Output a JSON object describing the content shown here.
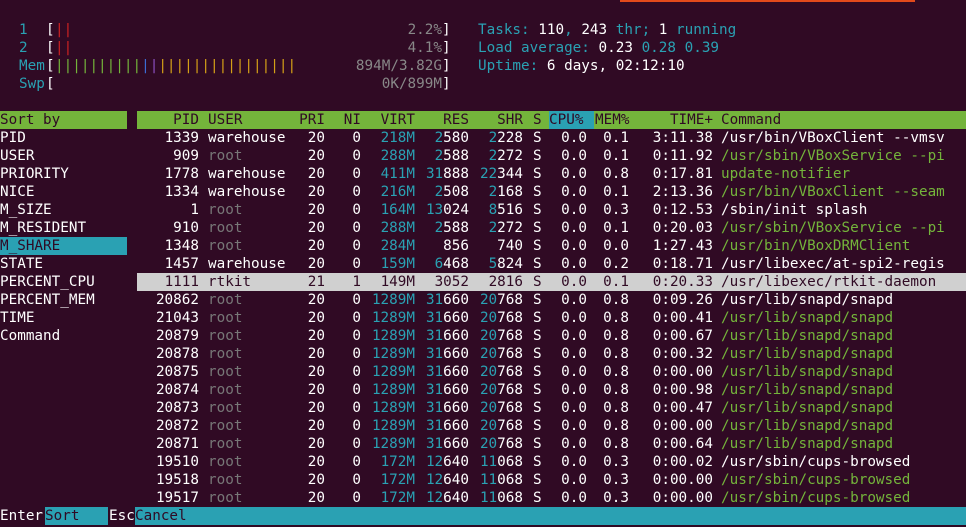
{
  "meters": {
    "cpu1": {
      "label": "1",
      "bars": "||",
      "value": "2.2%",
      "percent": 2.2
    },
    "cpu2": {
      "label": "2",
      "bars": "||",
      "value": "4.1%",
      "percent": 4.1
    },
    "mem": {
      "label": "Mem",
      "bars": "||||||||||||||||||||||||||||",
      "value": "894M/3.82G"
    },
    "swp": {
      "label": "Swp",
      "bars": "",
      "value": "0K/899M"
    }
  },
  "stats": {
    "tasks_label": "Tasks: ",
    "tasks": "110",
    "thr": "243",
    "thr_label": " thr; ",
    "running": "1",
    "running_label": " running",
    "load_label": "Load average: ",
    "load1": "0.23",
    "load5": "0.28",
    "load15": "0.39",
    "uptime_label": "Uptime: ",
    "uptime": "6 days, 02:12:10"
  },
  "sort_panel": {
    "title": "Sort by",
    "selected_index": 6,
    "items": [
      "PID",
      "USER",
      "PRIORITY",
      "NICE",
      "M_SIZE",
      "M_RESIDENT",
      "M_SHARE",
      "STATE",
      "PERCENT_CPU",
      "PERCENT_MEM",
      "TIME",
      "Command"
    ]
  },
  "columns": {
    "pid": "PID",
    "user": "USER",
    "pri": "PRI",
    "ni": "NI",
    "virt": "VIRT",
    "res": "RES",
    "shr": "SHR",
    "s": "S",
    "cpu": "CPU%",
    "mem": "MEM%",
    "time": "TIME+",
    "cmd": "Command"
  },
  "processes": [
    {
      "pid": "1339",
      "user": "warehouse",
      "pri": "20",
      "ni": "0",
      "virt": "218M",
      "res": "2580",
      "shr": "2228",
      "s": "S",
      "cpu": "0.0",
      "mem": "0.1",
      "time": "3:11.38",
      "cmd": "/usr/bin/VBoxClient --vmsv",
      "thread": false,
      "sel": false
    },
    {
      "pid": "909",
      "user": "root",
      "pri": "20",
      "ni": "0",
      "virt": "288M",
      "res": "2588",
      "shr": "2272",
      "s": "S",
      "cpu": "0.0",
      "mem": "0.1",
      "time": "0:11.92",
      "cmd": "/usr/sbin/VBoxService --pi",
      "thread": true,
      "sel": false
    },
    {
      "pid": "1778",
      "user": "warehouse",
      "pri": "20",
      "ni": "0",
      "virt": "411M",
      "res": "31888",
      "shr": "22344",
      "s": "S",
      "cpu": "0.0",
      "mem": "0.8",
      "time": "0:17.81",
      "cmd": "update-notifier",
      "thread": true,
      "sel": false
    },
    {
      "pid": "1334",
      "user": "warehouse",
      "pri": "20",
      "ni": "0",
      "virt": "216M",
      "res": "2508",
      "shr": "2168",
      "s": "S",
      "cpu": "0.0",
      "mem": "0.1",
      "time": "2:13.36",
      "cmd": "/usr/bin/VBoxClient --seam",
      "thread": true,
      "sel": false
    },
    {
      "pid": "1",
      "user": "root",
      "pri": "20",
      "ni": "0",
      "virt": "164M",
      "res": "13024",
      "shr": "8516",
      "s": "S",
      "cpu": "0.0",
      "mem": "0.3",
      "time": "0:12.53",
      "cmd": "/sbin/init splash",
      "thread": false,
      "sel": false
    },
    {
      "pid": "910",
      "user": "root",
      "pri": "20",
      "ni": "0",
      "virt": "288M",
      "res": "2588",
      "shr": "2272",
      "s": "S",
      "cpu": "0.0",
      "mem": "0.1",
      "time": "0:20.03",
      "cmd": "/usr/sbin/VBoxService --pi",
      "thread": true,
      "sel": false
    },
    {
      "pid": "1348",
      "user": "root",
      "pri": "20",
      "ni": "0",
      "virt": "284M",
      "res": "856",
      "shr": "740",
      "s": "S",
      "cpu": "0.0",
      "mem": "0.0",
      "time": "1:27.43",
      "cmd": "/usr/bin/VBoxDRMClient",
      "thread": true,
      "sel": false
    },
    {
      "pid": "1457",
      "user": "warehouse",
      "pri": "20",
      "ni": "0",
      "virt": "159M",
      "res": "6468",
      "shr": "5824",
      "s": "S",
      "cpu": "0.0",
      "mem": "0.2",
      "time": "0:18.71",
      "cmd": "/usr/libexec/at-spi2-regis",
      "thread": false,
      "sel": false
    },
    {
      "pid": "1111",
      "user": "rtkit",
      "pri": "21",
      "ni": "1",
      "virt": "149M",
      "res": "3052",
      "shr": "2816",
      "s": "S",
      "cpu": "0.0",
      "mem": "0.1",
      "time": "0:20.33",
      "cmd": "/usr/libexec/rtkit-daemon",
      "thread": false,
      "sel": true
    },
    {
      "pid": "20862",
      "user": "root",
      "pri": "20",
      "ni": "0",
      "virt": "1289M",
      "res": "31660",
      "shr": "20768",
      "s": "S",
      "cpu": "0.0",
      "mem": "0.8",
      "time": "0:09.26",
      "cmd": "/usr/lib/snapd/snapd",
      "thread": false,
      "sel": false
    },
    {
      "pid": "21043",
      "user": "root",
      "pri": "20",
      "ni": "0",
      "virt": "1289M",
      "res": "31660",
      "shr": "20768",
      "s": "S",
      "cpu": "0.0",
      "mem": "0.8",
      "time": "0:00.41",
      "cmd": "/usr/lib/snapd/snapd",
      "thread": true,
      "sel": false
    },
    {
      "pid": "20879",
      "user": "root",
      "pri": "20",
      "ni": "0",
      "virt": "1289M",
      "res": "31660",
      "shr": "20768",
      "s": "S",
      "cpu": "0.0",
      "mem": "0.8",
      "time": "0:00.67",
      "cmd": "/usr/lib/snapd/snapd",
      "thread": true,
      "sel": false
    },
    {
      "pid": "20878",
      "user": "root",
      "pri": "20",
      "ni": "0",
      "virt": "1289M",
      "res": "31660",
      "shr": "20768",
      "s": "S",
      "cpu": "0.0",
      "mem": "0.8",
      "time": "0:00.32",
      "cmd": "/usr/lib/snapd/snapd",
      "thread": true,
      "sel": false
    },
    {
      "pid": "20875",
      "user": "root",
      "pri": "20",
      "ni": "0",
      "virt": "1289M",
      "res": "31660",
      "shr": "20768",
      "s": "S",
      "cpu": "0.0",
      "mem": "0.8",
      "time": "0:00.00",
      "cmd": "/usr/lib/snapd/snapd",
      "thread": true,
      "sel": false
    },
    {
      "pid": "20874",
      "user": "root",
      "pri": "20",
      "ni": "0",
      "virt": "1289M",
      "res": "31660",
      "shr": "20768",
      "s": "S",
      "cpu": "0.0",
      "mem": "0.8",
      "time": "0:00.98",
      "cmd": "/usr/lib/snapd/snapd",
      "thread": true,
      "sel": false
    },
    {
      "pid": "20873",
      "user": "root",
      "pri": "20",
      "ni": "0",
      "virt": "1289M",
      "res": "31660",
      "shr": "20768",
      "s": "S",
      "cpu": "0.0",
      "mem": "0.8",
      "time": "0:00.47",
      "cmd": "/usr/lib/snapd/snapd",
      "thread": true,
      "sel": false
    },
    {
      "pid": "20872",
      "user": "root",
      "pri": "20",
      "ni": "0",
      "virt": "1289M",
      "res": "31660",
      "shr": "20768",
      "s": "S",
      "cpu": "0.0",
      "mem": "0.8",
      "time": "0:00.00",
      "cmd": "/usr/lib/snapd/snapd",
      "thread": true,
      "sel": false
    },
    {
      "pid": "20871",
      "user": "root",
      "pri": "20",
      "ni": "0",
      "virt": "1289M",
      "res": "31660",
      "shr": "20768",
      "s": "S",
      "cpu": "0.0",
      "mem": "0.8",
      "time": "0:00.64",
      "cmd": "/usr/lib/snapd/snapd",
      "thread": true,
      "sel": false
    },
    {
      "pid": "19510",
      "user": "root",
      "pri": "20",
      "ni": "0",
      "virt": "172M",
      "res": "12640",
      "shr": "11068",
      "s": "S",
      "cpu": "0.0",
      "mem": "0.3",
      "time": "0:00.02",
      "cmd": "/usr/sbin/cups-browsed",
      "thread": false,
      "sel": false
    },
    {
      "pid": "19518",
      "user": "root",
      "pri": "20",
      "ni": "0",
      "virt": "172M",
      "res": "12640",
      "shr": "11068",
      "s": "S",
      "cpu": "0.0",
      "mem": "0.3",
      "time": "0:00.00",
      "cmd": "/usr/sbin/cups-browsed",
      "thread": true,
      "sel": false
    },
    {
      "pid": "19517",
      "user": "root",
      "pri": "20",
      "ni": "0",
      "virt": "172M",
      "res": "12640",
      "shr": "11068",
      "s": "S",
      "cpu": "0.0",
      "mem": "0.3",
      "time": "0:00.00",
      "cmd": "/usr/sbin/cups-browsed",
      "thread": true,
      "sel": false
    }
  ],
  "footer": {
    "key1": "Enter",
    "label1": "Sort",
    "key2": "Esc",
    "label2": "Cancel"
  },
  "colors": {
    "background": "#300a24",
    "teal": "#2aa1b3",
    "green": "#74b43b",
    "red": "#cc2222",
    "gray": "#777777"
  }
}
